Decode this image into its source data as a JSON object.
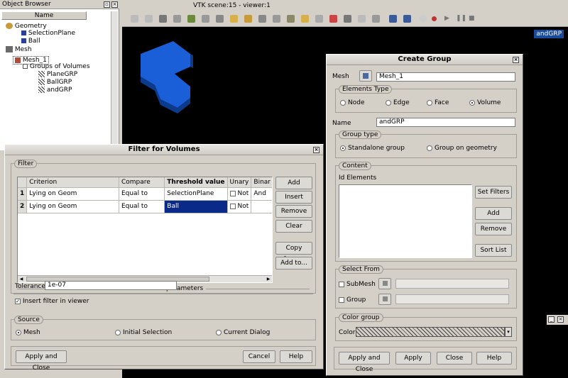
{
  "object_browser": {
    "title": "Object Browser",
    "column_header": "Name",
    "tree": [
      {
        "label": "Geometry",
        "level": 0
      },
      {
        "label": "SelectionPlane",
        "level": 1
      },
      {
        "label": "Ball",
        "level": 1
      },
      {
        "label": "Mesh",
        "level": 0
      },
      {
        "label": "Mesh_1",
        "level": 1
      },
      {
        "label": "Groups of Volumes",
        "level": 2
      },
      {
        "label": "PlaneGRP",
        "level": 3
      },
      {
        "label": "BallGRP",
        "level": 3
      },
      {
        "label": "andGRP",
        "level": 3
      }
    ]
  },
  "viewer": {
    "title": "VTK scene:15 - viewer:1",
    "badge": "andGRP",
    "accent": "#1a5fd8"
  },
  "filter_dialog": {
    "title": "Filter for Volumes",
    "filter_legend": "Filter",
    "columns": [
      "Criterion",
      "Compare",
      "Threshold value",
      "Unary",
      "Binar"
    ],
    "rows": [
      {
        "num": "1",
        "criterion": "Lying on Geom",
        "compare": "Equal to",
        "threshold": "SelectionPlane",
        "unary": "Not",
        "binary": "And"
      },
      {
        "num": "2",
        "criterion": "Lying on Geom",
        "compare": "Equal to",
        "threshold": "Ball",
        "unary": "Not",
        "binary": ""
      }
    ],
    "side_buttons": [
      "Add",
      "Insert",
      "Remove",
      "Clear",
      "Copy from...",
      "Add to..."
    ],
    "additional_parameters": "Additional parameters",
    "tolerance_label": "Tolerance",
    "tolerance_value": "1e-07",
    "insert_filter_label": "Insert filter in viewer",
    "source_legend": "Source",
    "source_options": [
      "Mesh",
      "Initial Selection",
      "Current Dialog"
    ],
    "apply_close": "Apply and Close",
    "cancel": "Cancel",
    "help": "Help"
  },
  "create_group": {
    "title": "Create Group",
    "mesh_label": "Mesh",
    "mesh_value": "Mesh_1",
    "elements_type_legend": "Elements Type",
    "element_types": [
      "Node",
      "Edge",
      "Face",
      "Volume"
    ],
    "name_label": "Name",
    "name_value": "andGRP",
    "group_type_legend": "Group type",
    "group_types": [
      "Standalone group",
      "Group on geometry"
    ],
    "content_legend": "Content",
    "id_elements_label": "Id Elements",
    "content_buttons": [
      "Set Filters",
      "Add",
      "Remove",
      "Sort List"
    ],
    "select_from_legend": "Select From",
    "submesh_label": "SubMesh",
    "group_label": "Group",
    "color_group_legend": "Color group",
    "color_label": "Color",
    "buttons": [
      "Apply and Close",
      "Apply",
      "Close",
      "Help"
    ]
  }
}
